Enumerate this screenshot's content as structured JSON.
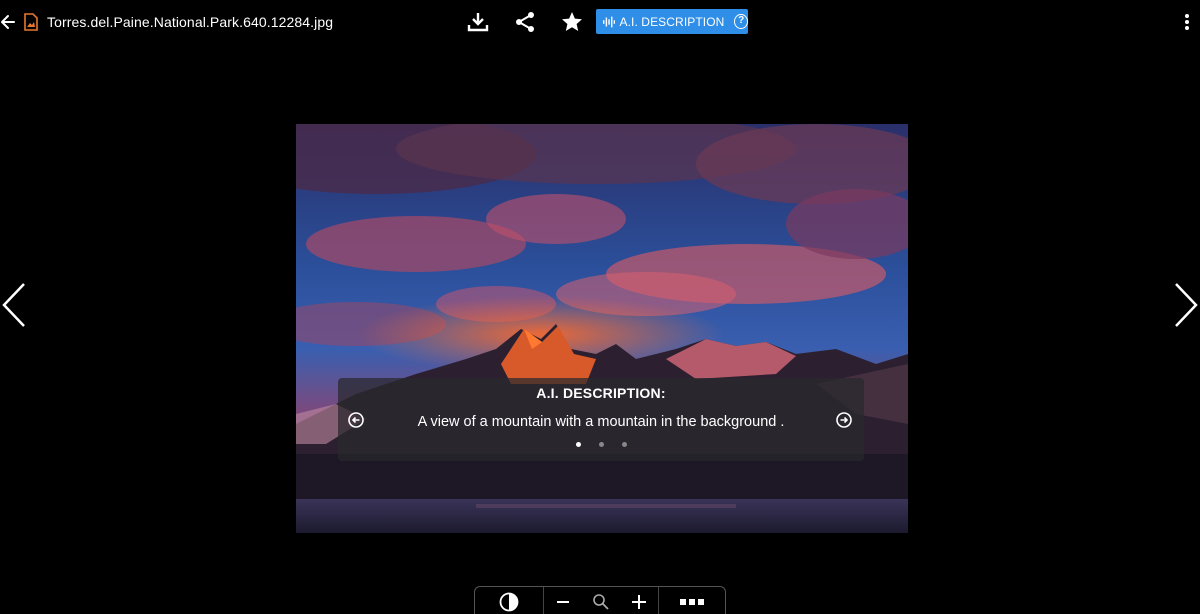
{
  "header": {
    "file_name": "Torres.del.Paine.National.Park.640.12284.jpg",
    "ai_button_label": "A.I. DESCRIPTION",
    "help_symbol": "?",
    "accent_color": "#2e8ee8",
    "file_icon_color": "#e8772e"
  },
  "caption": {
    "title": "A.I. DESCRIPTION:",
    "text": "A view of a mountain with a mountain in the background .",
    "dots_total": 3,
    "dot_active": 1
  },
  "toolbar": {
    "items": [
      "contrast-icon",
      "zoom-out-icon",
      "zoom-icon",
      "zoom-in-icon",
      "more-horizontal-icon"
    ]
  }
}
